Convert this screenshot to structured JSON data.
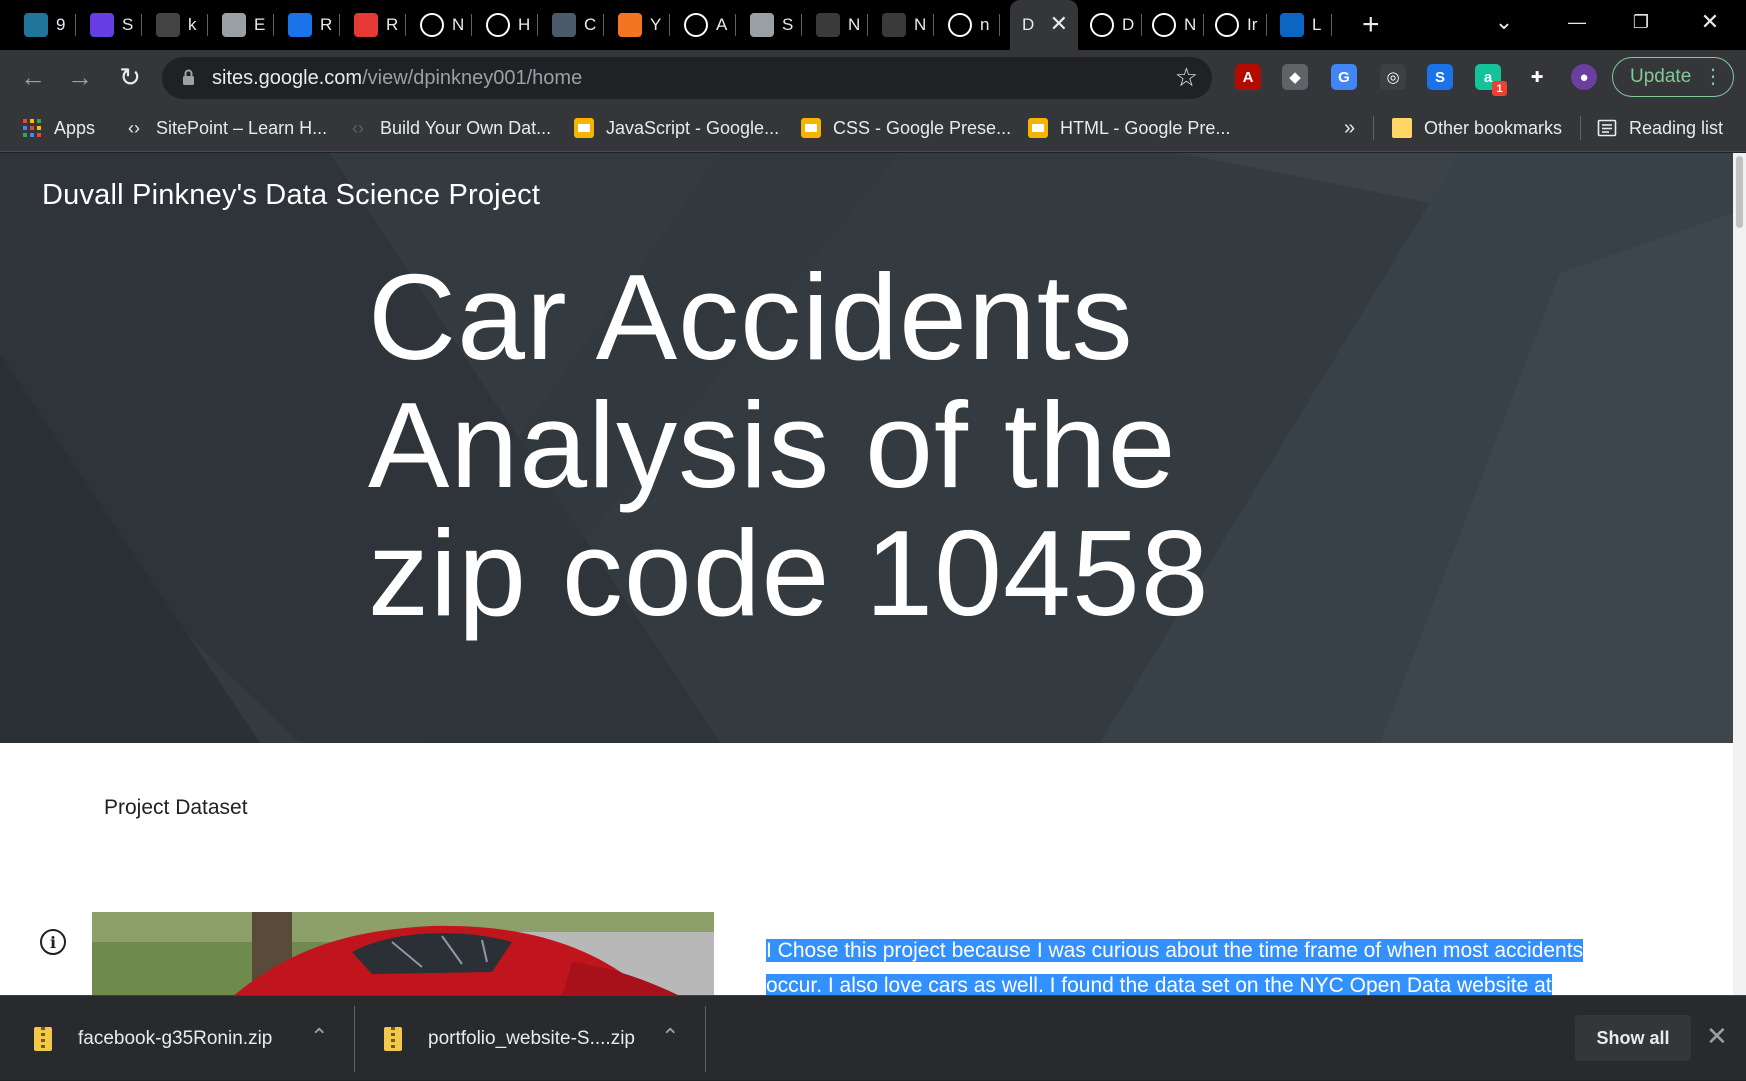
{
  "tabs": [
    {
      "label": "9",
      "icon": "wordpress-icon",
      "color": "#21759b"
    },
    {
      "label": "S",
      "icon": "hostinger-icon",
      "color": "#673de6"
    },
    {
      "label": "k",
      "icon": "small-triangle-icon",
      "color": "#444444"
    },
    {
      "label": "E",
      "icon": "globe-icon",
      "color": "#9aa0a6"
    },
    {
      "label": "R",
      "icon": "lightning-icon",
      "color": "#1a73e8"
    },
    {
      "label": "R",
      "icon": "arrow-icon",
      "color": "#e53935"
    },
    {
      "label": "N",
      "icon": "chrome-icon",
      "color": "#ffffff"
    },
    {
      "label": "H",
      "icon": "codepen-icon",
      "color": "#ffffff"
    },
    {
      "label": "C",
      "icon": "tds-icon",
      "color": "#4b5b6b"
    },
    {
      "label": "Y",
      "icon": "crunchyroll-icon",
      "color": "#f47521"
    },
    {
      "label": "A",
      "icon": "amazon-icon",
      "color": "#ffffff"
    },
    {
      "label": "S",
      "icon": "globe-icon",
      "color": "#9aa0a6"
    },
    {
      "label": "N",
      "icon": "blackboard-icon",
      "color": "#3a3a3a"
    },
    {
      "label": "N",
      "icon": "blackboard-icon",
      "color": "#3a3a3a"
    },
    {
      "label": "n",
      "icon": "github-icon",
      "color": "#ffffff"
    },
    {
      "label": "D",
      "icon": "",
      "color": "#35363a",
      "active": true
    },
    {
      "label": "D",
      "icon": "github-icon",
      "color": "#ffffff"
    },
    {
      "label": "N",
      "icon": "chrome-icon",
      "color": "#ffffff"
    },
    {
      "label": "Ir",
      "icon": "gmail-icon",
      "color": "#ffffff"
    },
    {
      "label": "L",
      "icon": "linkedin-icon",
      "color": "#0a66c2"
    }
  ],
  "tab_strip": {
    "close_glyph": "✕",
    "new_tab_glyph": "+",
    "tab_search_glyph": "⌄",
    "minimize_glyph": "—",
    "restore_glyph": "❐",
    "window_close_glyph": "✕"
  },
  "toolbar": {
    "back_glyph": "←",
    "forward_glyph": "→",
    "reload_glyph": "↻",
    "url_domain": "sites.google.com",
    "url_path": "/view/dpinkney001/home",
    "star_glyph": "☆",
    "update_label": "Update",
    "menu_glyph": "⋮",
    "extensions": [
      {
        "icon": "adobe-acrobat-icon",
        "color": "#b30b00",
        "glyph": "A"
      },
      {
        "icon": "cube-icon",
        "color": "#5f6368",
        "glyph": "◆"
      },
      {
        "icon": "google-translate-icon",
        "color": "#4285f4",
        "glyph": "G"
      },
      {
        "icon": "podcast-icon",
        "color": "#3c4043",
        "glyph": "◎"
      },
      {
        "icon": "skype-icon",
        "color": "#1a73e8",
        "glyph": "S"
      },
      {
        "icon": "grammarly-icon",
        "color": "#15c39a",
        "glyph": "a"
      },
      {
        "icon": "puzzle-icon",
        "color": "#35363a",
        "glyph": "✚"
      },
      {
        "icon": "avatar",
        "color": "#6b3fa0",
        "glyph": "●"
      }
    ],
    "grammarly_badge": "1"
  },
  "bookmarks": {
    "items": [
      {
        "label": "Apps",
        "icon": "apps-grid-icon"
      },
      {
        "label": "SitePoint – Learn H...",
        "icon": "sitepoint-icon"
      },
      {
        "label": "Build Your Own Dat...",
        "icon": "sitepoint-icon"
      },
      {
        "label": "JavaScript - Google...",
        "icon": "google-slides-icon"
      },
      {
        "label": "CSS - Google Prese...",
        "icon": "google-slides-icon"
      },
      {
        "label": "HTML - Google Pre...",
        "icon": "google-slides-icon"
      }
    ],
    "overflow_glyph": "»",
    "other_bookmarks": "Other bookmarks",
    "reading_list": "Reading list"
  },
  "page": {
    "site_title": "Duvall Pinkney's Data Science Project",
    "hero_heading": "Car Accidents Analysis of the zip code 10458",
    "section_title": "Project Dataset",
    "info_glyph": "i",
    "description_line1": "I Chose this project because I was curious about the time frame of when most accidents",
    "description_line2": "occur. I also love cars as well. I found the data set on the NYC Open Data website at"
  },
  "downloads": {
    "items": [
      {
        "filename": "facebook-g35Ronin.zip"
      },
      {
        "filename": "portfolio_website-S....zip"
      }
    ],
    "chevron_glyph": "⌃",
    "show_all_label": "Show all",
    "close_glyph": "✕"
  },
  "colors": {
    "hero_background": "#343b40",
    "selection_highlight": "#3390ff",
    "update_accent": "#81c995"
  }
}
